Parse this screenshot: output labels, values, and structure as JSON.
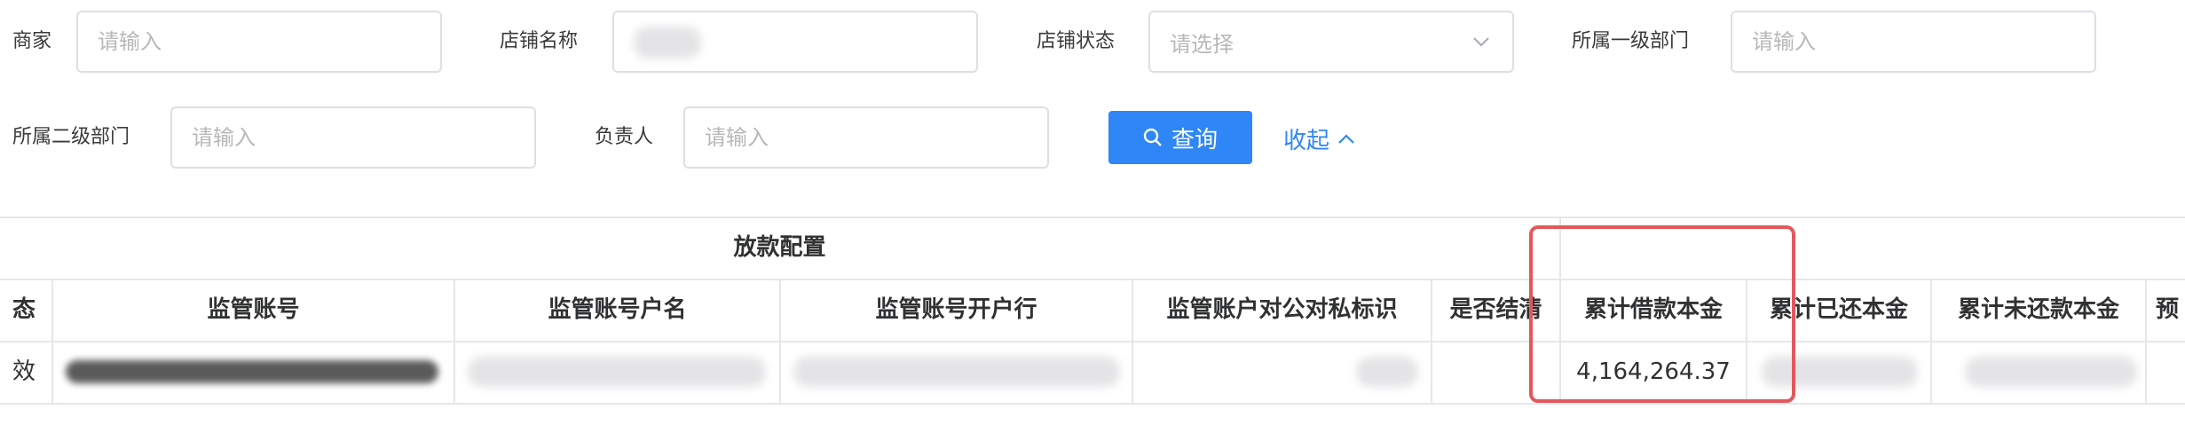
{
  "filters": {
    "merchant": {
      "label": "商家",
      "placeholder": "请输入"
    },
    "store_name": {
      "label": "店铺名称",
      "value": ""
    },
    "store_status": {
      "label": "店铺状态",
      "placeholder": "请选择"
    },
    "dept_level1": {
      "label": "所属一级部门",
      "placeholder": "请输入"
    },
    "dept_level2": {
      "label": "所属二级部门",
      "placeholder": "请输入"
    },
    "owner": {
      "label": "负责人",
      "placeholder": "请输入"
    },
    "query_button": "查询",
    "collapse_link": "收起"
  },
  "table": {
    "group_header": "放款配置",
    "columns": [
      "态",
      "监管账号",
      "监管账号户名",
      "监管账号开户行",
      "监管账户对公对私标识",
      "是否结清",
      "累计借款本金",
      "累计已还本金",
      "累计未还款本金",
      "预"
    ],
    "row": {
      "status_fragment": "效",
      "cumulative_loan_principal": "4,164,264.37"
    }
  },
  "colors": {
    "primary": "#2f86f6",
    "highlight_border": "#e2585c",
    "border": "#dcdfe6"
  },
  "icons": [
    "search-icon",
    "chevron-down-icon",
    "chevron-up-icon"
  ]
}
